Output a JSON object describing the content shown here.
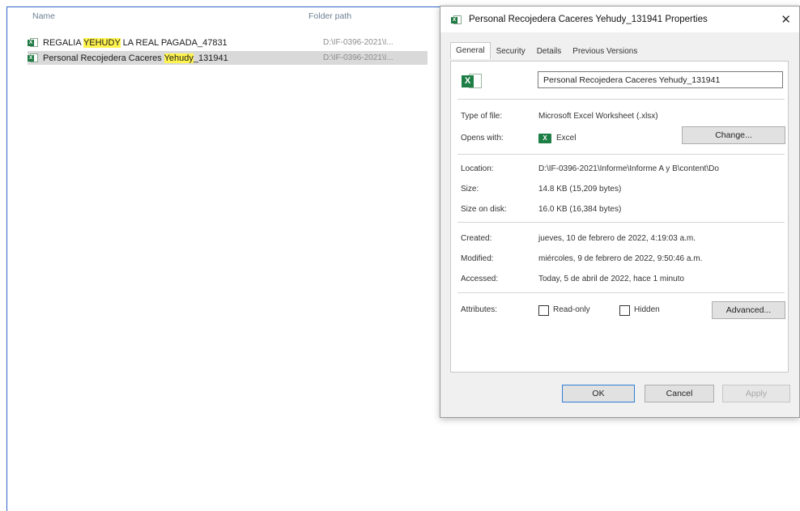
{
  "search": {
    "columns": {
      "name": "Name",
      "path": "Folder path"
    },
    "rows": [
      {
        "name_pre": "REGALIA ",
        "name_hl": "YEHUDY",
        "name_post": " LA REAL PAGADA_47831",
        "path": "D:\\IF-0396-2021\\I..."
      },
      {
        "name_pre": "Personal Recojedera Caceres ",
        "name_hl": "Yehudy",
        "name_post": "_131941",
        "path": "D:\\IF-0396-2021\\I..."
      }
    ]
  },
  "dialog": {
    "title": "Personal Recojedera Caceres Yehudy_131941 Properties",
    "close_glyph": "✕",
    "tabs": [
      "General",
      "Security",
      "Details",
      "Previous Versions"
    ],
    "file_name": "Personal Recojedera Caceres Yehudy_131941",
    "type_label": "Type of file:",
    "type_value": "Microsoft Excel Worksheet (.xlsx)",
    "opens_label": "Opens with:",
    "opens_value": "Excel",
    "change_label": "Change...",
    "location_label": "Location:",
    "location_value": "D:\\IF-0396-2021\\Informe\\Informe A y B\\content\\Do",
    "size_label": "Size:",
    "size_value": "14.8 KB (15,209 bytes)",
    "disk_label": "Size on disk:",
    "disk_value": "16.0 KB (16,384 bytes)",
    "created_label": "Created:",
    "created_value": "jueves, 10 de febrero de 2022, 4:19:03 a.m.",
    "modified_label": "Modified:",
    "modified_value": "miércoles, 9 de febrero de 2022, 9:50:46 a.m.",
    "accessed_label": "Accessed:",
    "accessed_value": "Today, 5 de abril de 2022, hace 1 minuto",
    "attributes_label": "Attributes:",
    "readonly_label": "Read-only",
    "hidden_label": "Hidden",
    "advanced_label": "Advanced...",
    "ok_label": "OK",
    "cancel_label": "Cancel",
    "apply_label": "Apply"
  },
  "icons": {
    "excel": "excel-icon",
    "close": "close-icon"
  },
  "colors": {
    "highlight": "#fff44f",
    "excel_green": "#1d7f46",
    "selection": "#d9d9d9"
  }
}
